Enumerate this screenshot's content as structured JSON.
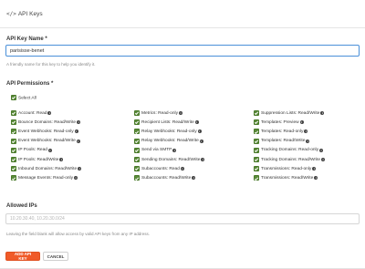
{
  "header": {
    "icon": "code-icon",
    "title": "API Keys"
  },
  "key_name": {
    "label": "API Key Name *",
    "value": "parisisse-benet",
    "help": "A friendly name for this key to help you identify it."
  },
  "permissions": {
    "label": "API Permissions *",
    "select_all": "Select All",
    "rows": [
      [
        "Account: Read",
        "Metrics: Read-only",
        "Suppression Lists: Read/Write"
      ],
      [
        "Bounce Domains: Read/Write",
        "Recipient Lists: Read/Write",
        "Templates: Preview"
      ],
      [
        "Event Webhooks: Read-only",
        "Relay Webhooks: Read-only",
        "Templates: Read-only"
      ],
      [
        "Event Webhooks: Read/Write",
        "Relay Webhooks: Read/Write",
        "Templates: Read/Write"
      ],
      [
        "IP Pools: Read",
        "Send via SMTP",
        "Tracking Domains: Read-only"
      ],
      [
        "IP Pools: Read/Write",
        "Sending Domains: Read/Write",
        "Tracking Domains: Read/Write"
      ],
      [
        "Inbound Domains: Read/Write",
        "Subaccounts: Read",
        "Transmissions: Read-only"
      ],
      [
        "Message Events: Read-only",
        "Subaccounts: Read/Write",
        "Transmissions: Read/Write"
      ]
    ]
  },
  "allowed_ips": {
    "label": "Allowed IPs",
    "placeholder": "10.20.30.40, 10.20.30.0/24",
    "help": "Leaving the field blank will allow access by valid API keys from any IP address."
  },
  "actions": {
    "add_label": "ADD API KEY",
    "cancel_label": "CANCEL"
  },
  "colors": {
    "accent": "#f05a28",
    "checkbox": "#5a8a3a",
    "focus_border": "#4a90d9"
  }
}
